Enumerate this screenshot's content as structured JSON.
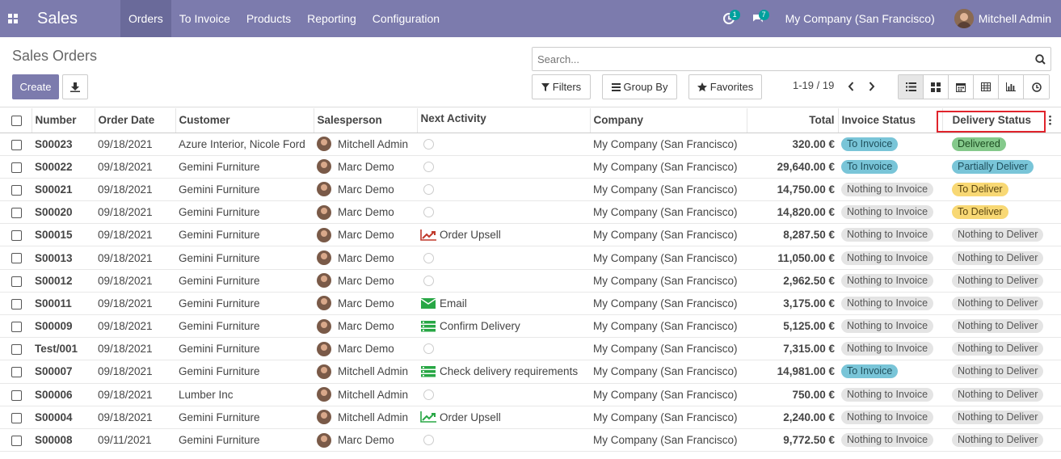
{
  "navbar": {
    "app_name": "Sales",
    "menu": [
      "Orders",
      "To Invoice",
      "Products",
      "Reporting",
      "Configuration"
    ],
    "activity_badge": "1",
    "message_badge": "7",
    "company": "My Company (San Francisco)",
    "user": "Mitchell Admin",
    "color": "#7c7bad"
  },
  "control_panel": {
    "title": "Sales Orders",
    "create_label": "Create",
    "search_placeholder": "Search...",
    "filters_label": "Filters",
    "groupby_label": "Group By",
    "favorites_label": "Favorites",
    "pager": "1-19 / 19"
  },
  "columns": [
    "Number",
    "Order Date",
    "Customer",
    "Salesperson",
    "Next Activity",
    "Company",
    "Total",
    "Invoice Status",
    "Delivery Status"
  ],
  "rows": [
    {
      "number": "S00023",
      "date": "09/18/2021",
      "customer": "Azure Interior, Nicole Ford",
      "salesperson": "Mitchell Admin",
      "activity": "",
      "activity_icon": "",
      "company": "My Company (San Francisco)",
      "total": "320.00 €",
      "invoice": "To Invoice",
      "invoice_color": "blue",
      "delivery": "Delivered",
      "delivery_color": "green"
    },
    {
      "number": "S00022",
      "date": "09/18/2021",
      "customer": "Gemini Furniture",
      "salesperson": "Marc Demo",
      "activity": "",
      "activity_icon": "",
      "company": "My Company (San Francisco)",
      "total": "29,640.00 €",
      "invoice": "To Invoice",
      "invoice_color": "blue",
      "delivery": "Partially Deliver",
      "delivery_color": "blue"
    },
    {
      "number": "S00021",
      "date": "09/18/2021",
      "customer": "Gemini Furniture",
      "salesperson": "Marc Demo",
      "activity": "",
      "activity_icon": "",
      "company": "My Company (San Francisco)",
      "total": "14,750.00 €",
      "invoice": "Nothing to Invoice",
      "invoice_color": "grey",
      "delivery": "To Deliver",
      "delivery_color": "yellow"
    },
    {
      "number": "S00020",
      "date": "09/18/2021",
      "customer": "Gemini Furniture",
      "salesperson": "Marc Demo",
      "activity": "",
      "activity_icon": "",
      "company": "My Company (San Francisco)",
      "total": "14,820.00 €",
      "invoice": "Nothing to Invoice",
      "invoice_color": "grey",
      "delivery": "To Deliver",
      "delivery_color": "yellow"
    },
    {
      "number": "S00015",
      "date": "09/18/2021",
      "customer": "Gemini Furniture",
      "salesperson": "Marc Demo",
      "activity": "Order Upsell",
      "activity_icon": "upsell-red",
      "company": "My Company (San Francisco)",
      "total": "8,287.50 €",
      "invoice": "Nothing to Invoice",
      "invoice_color": "grey",
      "delivery": "Nothing to Deliver",
      "delivery_color": "grey"
    },
    {
      "number": "S00013",
      "date": "09/18/2021",
      "customer": "Gemini Furniture",
      "salesperson": "Marc Demo",
      "activity": "",
      "activity_icon": "",
      "company": "My Company (San Francisco)",
      "total": "11,050.00 €",
      "invoice": "Nothing to Invoice",
      "invoice_color": "grey",
      "delivery": "Nothing to Deliver",
      "delivery_color": "grey"
    },
    {
      "number": "S00012",
      "date": "09/18/2021",
      "customer": "Gemini Furniture",
      "salesperson": "Marc Demo",
      "activity": "",
      "activity_icon": "",
      "company": "My Company (San Francisco)",
      "total": "2,962.50 €",
      "invoice": "Nothing to Invoice",
      "invoice_color": "grey",
      "delivery": "Nothing to Deliver",
      "delivery_color": "grey"
    },
    {
      "number": "S00011",
      "date": "09/18/2021",
      "customer": "Gemini Furniture",
      "salesperson": "Marc Demo",
      "activity": "Email",
      "activity_icon": "email-green",
      "company": "My Company (San Francisco)",
      "total": "3,175.00 €",
      "invoice": "Nothing to Invoice",
      "invoice_color": "grey",
      "delivery": "Nothing to Deliver",
      "delivery_color": "grey"
    },
    {
      "number": "S00009",
      "date": "09/18/2021",
      "customer": "Gemini Furniture",
      "salesperson": "Marc Demo",
      "activity": "Confirm Delivery",
      "activity_icon": "tasks-green",
      "company": "My Company (San Francisco)",
      "total": "5,125.00 €",
      "invoice": "Nothing to Invoice",
      "invoice_color": "grey",
      "delivery": "Nothing to Deliver",
      "delivery_color": "grey"
    },
    {
      "number": "Test/001",
      "date": "09/18/2021",
      "customer": "Gemini Furniture",
      "salesperson": "Marc Demo",
      "activity": "",
      "activity_icon": "",
      "company": "My Company (San Francisco)",
      "total": "7,315.00 €",
      "invoice": "Nothing to Invoice",
      "invoice_color": "grey",
      "delivery": "Nothing to Deliver",
      "delivery_color": "grey"
    },
    {
      "number": "S00007",
      "date": "09/18/2021",
      "customer": "Gemini Furniture",
      "salesperson": "Mitchell Admin",
      "activity": "Check delivery requirements",
      "activity_icon": "tasks-green",
      "company": "My Company (San Francisco)",
      "total": "14,981.00 €",
      "invoice": "To Invoice",
      "invoice_color": "blue",
      "delivery": "Nothing to Deliver",
      "delivery_color": "grey"
    },
    {
      "number": "S00006",
      "date": "09/18/2021",
      "customer": "Lumber Inc",
      "salesperson": "Mitchell Admin",
      "activity": "",
      "activity_icon": "",
      "company": "My Company (San Francisco)",
      "total": "750.00 €",
      "invoice": "Nothing to Invoice",
      "invoice_color": "grey",
      "delivery": "Nothing to Deliver",
      "delivery_color": "grey"
    },
    {
      "number": "S00004",
      "date": "09/18/2021",
      "customer": "Gemini Furniture",
      "salesperson": "Mitchell Admin",
      "activity": "Order Upsell",
      "activity_icon": "upsell-green",
      "company": "My Company (San Francisco)",
      "total": "2,240.00 €",
      "invoice": "Nothing to Invoice",
      "invoice_color": "grey",
      "delivery": "Nothing to Deliver",
      "delivery_color": "grey"
    },
    {
      "number": "S00008",
      "date": "09/11/2021",
      "customer": "Gemini Furniture",
      "salesperson": "Marc Demo",
      "activity": "",
      "activity_icon": "",
      "company": "My Company (San Francisco)",
      "total": "9,772.50 €",
      "invoice": "Nothing to Invoice",
      "invoice_color": "grey",
      "delivery": "Nothing to Deliver",
      "delivery_color": "grey"
    }
  ]
}
